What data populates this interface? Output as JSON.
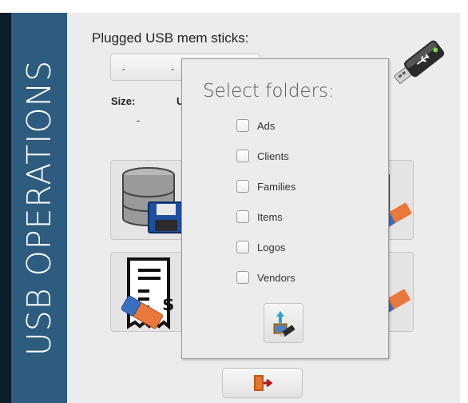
{
  "sidebar": {
    "title": "USB OPERATIONS"
  },
  "usb": {
    "plugged_label": "Plugged USB mem sticks:",
    "selector": {
      "part1": "-",
      "part2": "-"
    },
    "size_label": "Size:",
    "size_value": "-",
    "partial_label": "U"
  },
  "dialog": {
    "title": "Select folders:",
    "folders": [
      {
        "label": "Ads",
        "checked": false
      },
      {
        "label": "Clients",
        "checked": false
      },
      {
        "label": "Families",
        "checked": false
      },
      {
        "label": "Items",
        "checked": false
      },
      {
        "label": "Logos",
        "checked": false
      },
      {
        "label": "Vendors",
        "checked": false
      }
    ],
    "confirm_icon": "export-to-usb-icon"
  },
  "operations": [
    {
      "icon": "database-save-icon"
    },
    {
      "icon": "database-erase-icon"
    },
    {
      "icon": "receipt-erase-icon"
    },
    {
      "icon": "erase-icon"
    }
  ],
  "exit": {
    "icon": "exit-door-icon"
  },
  "colors": {
    "sidebar": "#2e5c7f",
    "panel": "#ececec",
    "dialog_border": "#9c9c9c"
  }
}
